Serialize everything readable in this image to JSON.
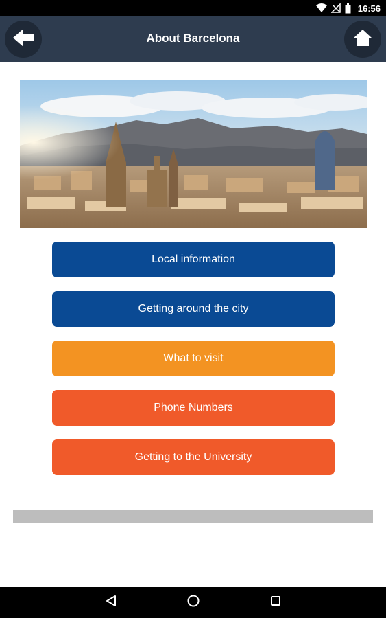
{
  "status_bar": {
    "time": "16:56",
    "icons": [
      "wifi-icon",
      "signal-off-icon",
      "battery-icon"
    ]
  },
  "app_bar": {
    "title": "About Barcelona",
    "back_icon": "arrow-left-icon",
    "home_icon": "home-icon",
    "background": "#2e3c4f"
  },
  "hero": {
    "subject": "Barcelona skyline photo"
  },
  "menu": {
    "items": [
      {
        "label": "Local information",
        "color": "#0a4a94"
      },
      {
        "label": "Getting around the city",
        "color": "#0a4a94"
      },
      {
        "label": "What to visit",
        "color": "#f39322"
      },
      {
        "label": "Phone Numbers",
        "color": "#f05a2a"
      },
      {
        "label": "Getting to the University",
        "color": "#f05a2a"
      }
    ]
  },
  "nav_bar": {
    "icons": [
      "nav-back-icon",
      "nav-home-icon",
      "nav-recents-icon"
    ]
  }
}
